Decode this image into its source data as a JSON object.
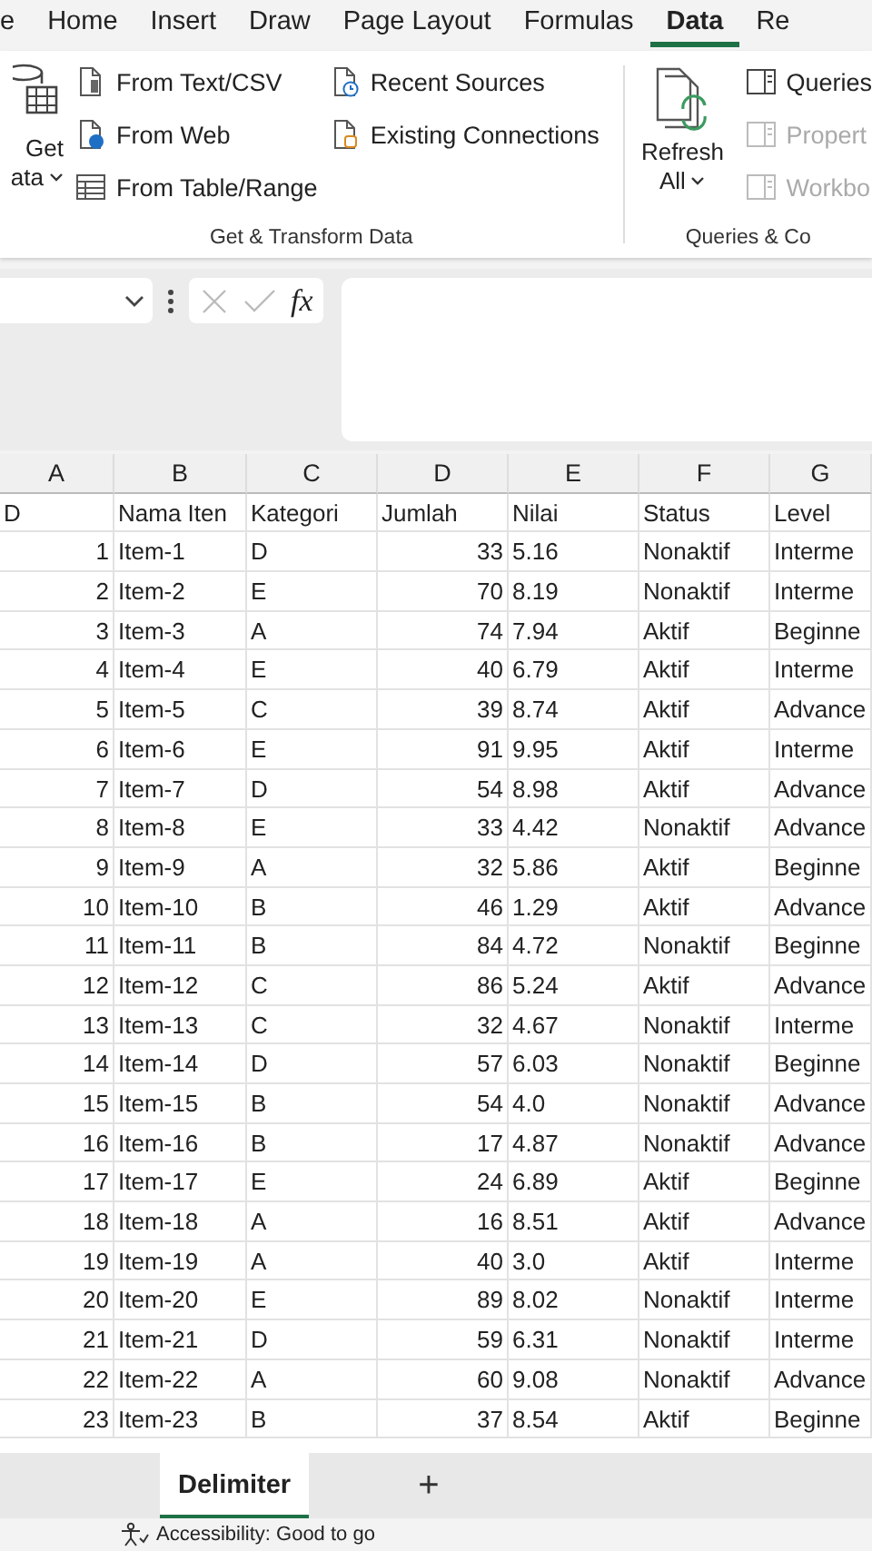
{
  "ribbon_tabs": [
    {
      "label": "e",
      "selected": false
    },
    {
      "label": "Home",
      "selected": false
    },
    {
      "label": "Insert",
      "selected": false
    },
    {
      "label": "Draw",
      "selected": false
    },
    {
      "label": "Page Layout",
      "selected": false
    },
    {
      "label": "Formulas",
      "selected": false
    },
    {
      "label": "Data",
      "selected": true
    },
    {
      "label": "Re",
      "selected": false
    }
  ],
  "ribbon": {
    "get_data": {
      "line_1": "Get",
      "line_2": "ata"
    },
    "get_transform": {
      "label": "Get & Transform Data",
      "column_1": [
        {
          "label": "From Text/CSV",
          "kind": "text"
        },
        {
          "label": "From Web",
          "kind": "web"
        },
        {
          "label": "From Table/Range",
          "kind": "table"
        }
      ],
      "column_2": [
        {
          "label": "Recent Sources",
          "kind": "recent"
        },
        {
          "label": "Existing Connections",
          "kind": "connections"
        }
      ]
    },
    "queries": {
      "label": "Queries & Co",
      "refresh": {
        "line_1": "Refresh",
        "line_2": "All"
      },
      "items": [
        {
          "label": "Queries",
          "disabled": false
        },
        {
          "label": "Propert",
          "disabled": true
        },
        {
          "label": "Workbo",
          "disabled": true
        }
      ]
    }
  },
  "formula_bar": {
    "function_button": "fx"
  },
  "sheet": {
    "columns": [
      "A",
      "B",
      "C",
      "D",
      "E",
      "F",
      "G"
    ],
    "header": [
      "D",
      "Nama Iten",
      "Kategori",
      "Jumlah",
      "Nilai",
      "Status",
      "Level"
    ],
    "rows": [
      [
        "1",
        "Item-1",
        "D",
        "33",
        "5.16",
        "Nonaktif",
        "Interme"
      ],
      [
        "2",
        "Item-2",
        "E",
        "70",
        "8.19",
        "Nonaktif",
        "Interme"
      ],
      [
        "3",
        "Item-3",
        "A",
        "74",
        "7.94",
        "Aktif",
        "Beginne"
      ],
      [
        "4",
        "Item-4",
        "E",
        "40",
        "6.79",
        "Aktif",
        "Interme"
      ],
      [
        "5",
        "Item-5",
        "C",
        "39",
        "8.74",
        "Aktif",
        "Advance"
      ],
      [
        "6",
        "Item-6",
        "E",
        "91",
        "9.95",
        "Aktif",
        "Interme"
      ],
      [
        "7",
        "Item-7",
        "D",
        "54",
        "8.98",
        "Aktif",
        "Advance"
      ],
      [
        "8",
        "Item-8",
        "E",
        "33",
        "4.42",
        "Nonaktif",
        "Advance"
      ],
      [
        "9",
        "Item-9",
        "A",
        "32",
        "5.86",
        "Aktif",
        "Beginne"
      ],
      [
        "10",
        "Item-10",
        "B",
        "46",
        "1.29",
        "Aktif",
        "Advance"
      ],
      [
        "11",
        "Item-11",
        "B",
        "84",
        "4.72",
        "Nonaktif",
        "Beginne"
      ],
      [
        "12",
        "Item-12",
        "C",
        "86",
        "5.24",
        "Aktif",
        "Advance"
      ],
      [
        "13",
        "Item-13",
        "C",
        "32",
        "4.67",
        "Nonaktif",
        "Interme"
      ],
      [
        "14",
        "Item-14",
        "D",
        "57",
        "6.03",
        "Nonaktif",
        "Beginne"
      ],
      [
        "15",
        "Item-15",
        "B",
        "54",
        "4.0",
        "Nonaktif",
        "Advance"
      ],
      [
        "16",
        "Item-16",
        "B",
        "17",
        "4.87",
        "Nonaktif",
        "Advance"
      ],
      [
        "17",
        "Item-17",
        "E",
        "24",
        "6.89",
        "Aktif",
        "Beginne"
      ],
      [
        "18",
        "Item-18",
        "A",
        "16",
        "8.51",
        "Aktif",
        "Advance"
      ],
      [
        "19",
        "Item-19",
        "A",
        "40",
        "3.0",
        "Aktif",
        "Interme"
      ],
      [
        "20",
        "Item-20",
        "E",
        "89",
        "8.02",
        "Nonaktif",
        "Interme"
      ],
      [
        "21",
        "Item-21",
        "D",
        "59",
        "6.31",
        "Nonaktif",
        "Interme"
      ],
      [
        "22",
        "Item-22",
        "A",
        "60",
        "9.08",
        "Nonaktif",
        "Advance"
      ],
      [
        "23",
        "Item-23",
        "B",
        "37",
        "8.54",
        "Aktif",
        "Beginne"
      ]
    ]
  },
  "sheet_tabs": [
    {
      "label": "Delimiter",
      "selected": true
    }
  ],
  "add_sheet": "+",
  "status_bar": {
    "accessibility": "Accessibility: Good to go"
  }
}
